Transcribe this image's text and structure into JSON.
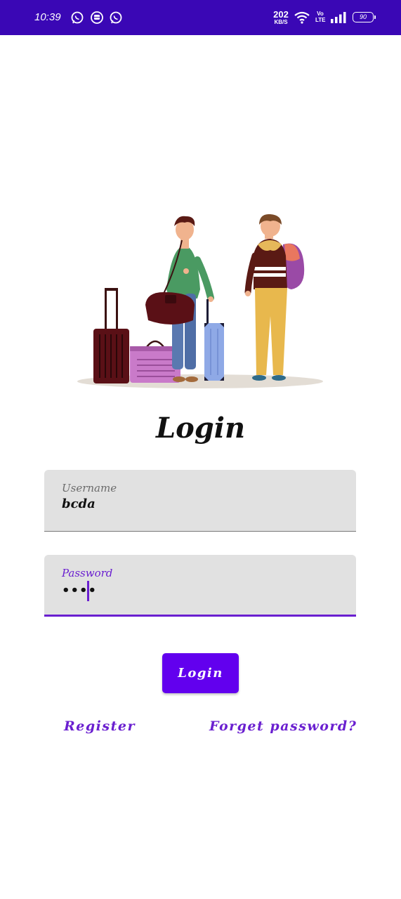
{
  "status_bar": {
    "time": "10:39",
    "notification_icons": [
      "whatsapp-icon",
      "notification-app-icon",
      "whatsapp-icon"
    ],
    "net_speed": "202",
    "net_speed_unit": "KB/S",
    "volte_top": "Vo",
    "volte_bottom": "LTE",
    "battery": "90"
  },
  "main": {
    "illustration": "travelers-with-luggage-illustration",
    "title": "Login",
    "username": {
      "label": "Username",
      "value": "bcda"
    },
    "password": {
      "label": "Password",
      "value": "••••"
    },
    "login_button": "Login",
    "register_link": "Register",
    "forget_link": "Forget password?"
  },
  "colors": {
    "status_bar": "#3a07b5",
    "accent": "#6200ee",
    "link": "#6a1fd0",
    "field_background": "#e1e1e1"
  }
}
